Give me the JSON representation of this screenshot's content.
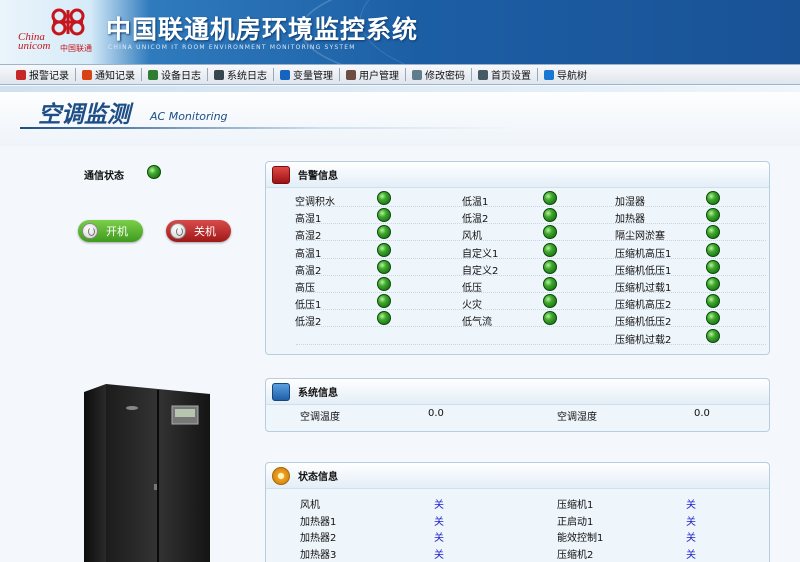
{
  "header": {
    "brand_en_line1": "China",
    "brand_en_line2": "unicom",
    "brand_cn": "中国联通",
    "title": "中国联通机房环境监控系统",
    "subtitle": "CHINA UNICOM IT ROOM ENVIRONMENT MONITORING SYSTEM"
  },
  "nav": [
    {
      "label": "报警记录",
      "icon": "alarm-record-icon",
      "color": "#c62828"
    },
    {
      "label": "通知记录",
      "icon": "notice-record-icon",
      "color": "#d84315"
    },
    {
      "label": "设备日志",
      "icon": "device-log-icon",
      "color": "#2e7d32"
    },
    {
      "label": "系统日志",
      "icon": "system-log-icon",
      "color": "#37474f"
    },
    {
      "label": "变量管理",
      "icon": "variable-manage-icon",
      "color": "#1565c0"
    },
    {
      "label": "用户管理",
      "icon": "user-manage-icon",
      "color": "#6d4c41"
    },
    {
      "label": "修改密码",
      "icon": "lock-icon",
      "color": "#607d8b"
    },
    {
      "label": "首页设置",
      "icon": "homepage-settings-icon",
      "color": "#455a64"
    },
    {
      "label": "导航树",
      "icon": "nav-tree-icon",
      "color": "#1976d2"
    }
  ],
  "page": {
    "title": "空调监测",
    "title_en": "AC Monitoring"
  },
  "comm": {
    "label": "通信状态"
  },
  "power": {
    "on_label": "开机",
    "off_label": "关机"
  },
  "alarm": {
    "title": "告警信息",
    "columns": [
      [
        "空调积水",
        "高湿1",
        "高湿2",
        "高温1",
        "高温2",
        "高压",
        "低压1",
        "低湿2"
      ],
      [
        "低温1",
        "低温2",
        "风机",
        "自定义1",
        "自定义2",
        "低压",
        "火灾",
        "低气流"
      ],
      [
        "加湿器",
        "加热器",
        "隔尘网淤塞",
        "压缩机高压1",
        "压缩机低压1",
        "压缩机过载1",
        "压缩机高压2",
        "压缩机低压2",
        "压缩机过载2"
      ]
    ]
  },
  "system": {
    "title": "系统信息",
    "temp_label": "空调温度",
    "temp_value": "0.0",
    "humidity_label": "空调湿度",
    "humidity_value": "0.0"
  },
  "status": {
    "title": "状态信息",
    "left": [
      {
        "label": "风机",
        "value": "关"
      },
      {
        "label": "加热器1",
        "value": "关"
      },
      {
        "label": "加热器2",
        "value": "关"
      },
      {
        "label": "加热器3",
        "value": "关"
      }
    ],
    "right": [
      {
        "label": "压缩机1",
        "value": "关"
      },
      {
        "label": "正启动1",
        "value": "关"
      },
      {
        "label": "能效控制1",
        "value": "关"
      },
      {
        "label": "压缩机2",
        "value": "关"
      }
    ]
  }
}
